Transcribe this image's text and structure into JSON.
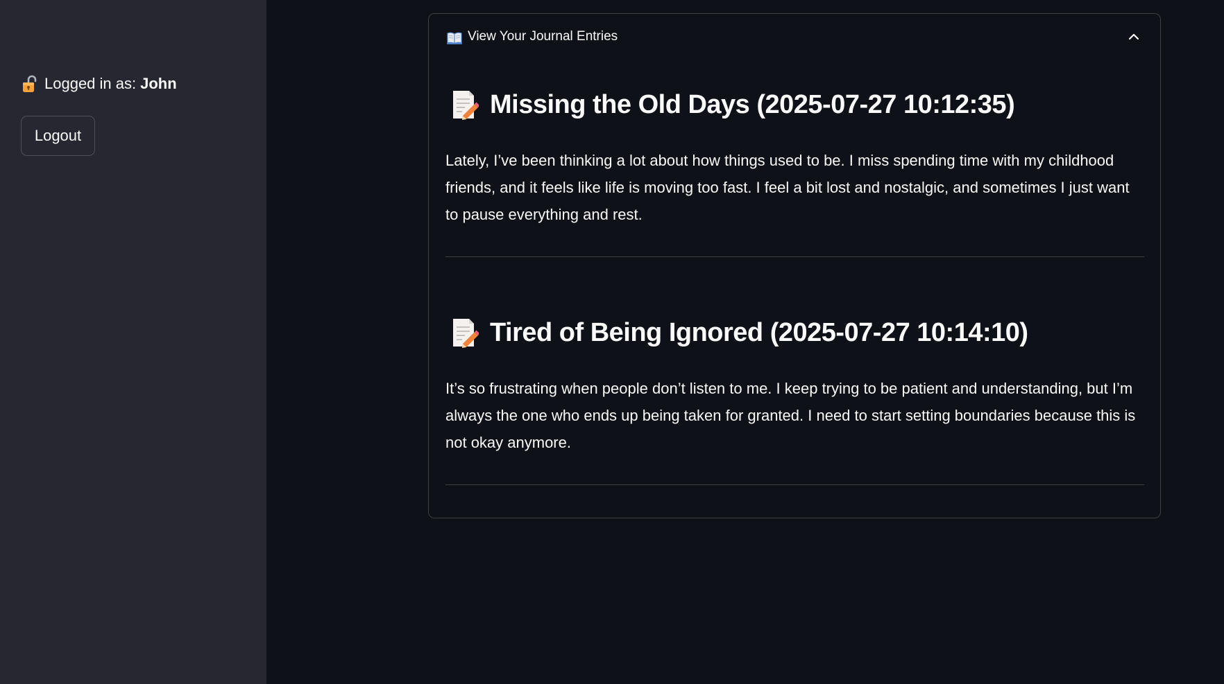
{
  "sidebar": {
    "login_prefix": "Logged in as:",
    "username": "John",
    "logout_label": "Logout"
  },
  "expander": {
    "title": "View Your Journal Entries",
    "expanded": true
  },
  "entries": [
    {
      "title": "Missing the Old Days (2025-07-27 10:12:35)",
      "body": "Lately, I’ve been thinking a lot about how things used to be. I miss spending time with my childhood friends, and it feels like life is moving too fast. I feel a bit lost and nostalgic, and sometimes I just want to pause everything and rest."
    },
    {
      "title": "Tired of Being Ignored (2025-07-27 10:14:10)",
      "body": "It’s so frustrating when people don’t listen to me. I keep trying to be patient and understanding, but I’m always the one who ends up being taken for granted. I need to start setting boundaries because this is not okay anymore."
    }
  ],
  "icons": {
    "login": "unlocked-lock-icon",
    "expander": "open-book-icon",
    "toggle": "chevron-up-icon",
    "entry": "memo-icon"
  },
  "colors": {
    "background": "#0e1117",
    "sidebar": "#262730",
    "text": "#fafafa",
    "border": "rgba(250,250,250,0.2)"
  }
}
